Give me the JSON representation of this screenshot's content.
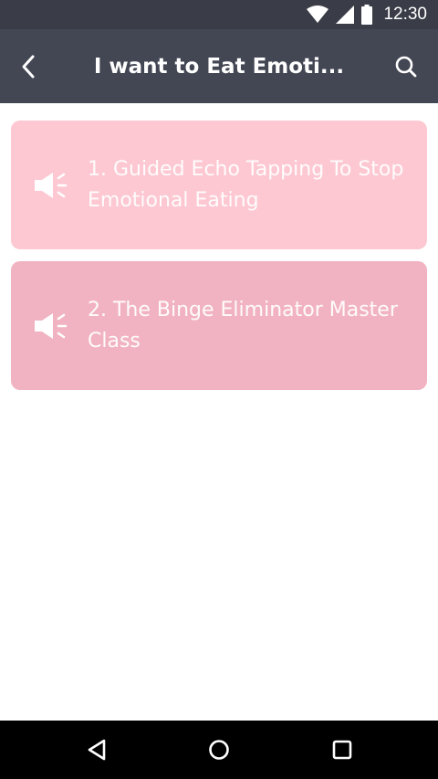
{
  "status_bar": {
    "time": "12:30",
    "icons": [
      "wifi-icon",
      "signal-icon",
      "battery-icon"
    ]
  },
  "header": {
    "title": "I want to Eat Emoti...",
    "back_icon": "chevron-left-icon",
    "search_icon": "search-icon"
  },
  "items": [
    {
      "label": "1. Guided Echo Tapping To Stop Emotional Eating",
      "color": "#fdc8d2",
      "icon": "speaker-icon"
    },
    {
      "label": "2. The Binge Eliminator Master Class",
      "color": "#f1b3c1",
      "icon": "speaker-icon"
    }
  ],
  "nav_bar": {
    "icons": [
      "back-triangle-icon",
      "home-circle-icon",
      "recents-square-icon"
    ]
  },
  "colors": {
    "status_bar": "#3a3c48",
    "app_bar": "#434653",
    "background": "#ffffff",
    "nav_bar": "#000000"
  }
}
